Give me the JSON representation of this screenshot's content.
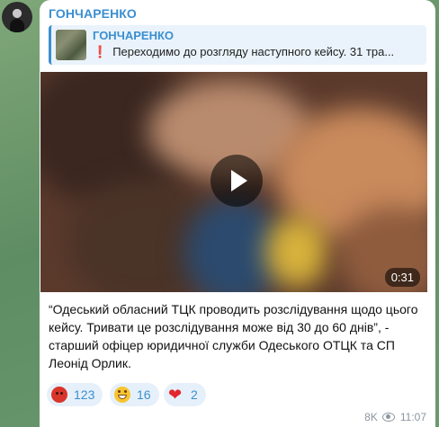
{
  "channel": {
    "sender_name": "ГОНЧАРЕНКО"
  },
  "reply": {
    "title": "ГОНЧАРЕНКО",
    "marker": "❗",
    "text": "Переходимо до розгляду наступного кейсу. 31 тра..."
  },
  "video": {
    "duration": "0:31"
  },
  "message": {
    "text": "“Одеський обласний ТЦК проводить розслідування щодо цього кейсу. Тривати це розслідування може від 30 до 60 днів”, - старший офіцер юридичної служби Одеського ОТЦК та СП Леонід Орлик."
  },
  "reactions": [
    {
      "icon": "angry-face-icon",
      "count": "123"
    },
    {
      "icon": "grinning-face-icon",
      "count": "16"
    },
    {
      "icon": "red-heart-icon",
      "count": "2"
    }
  ],
  "meta": {
    "views": "8K",
    "time": "11:07"
  },
  "colors": {
    "accent": "#3a8fd1",
    "reaction_bg": "#e6f0fa",
    "meta_text": "#8c959e"
  }
}
